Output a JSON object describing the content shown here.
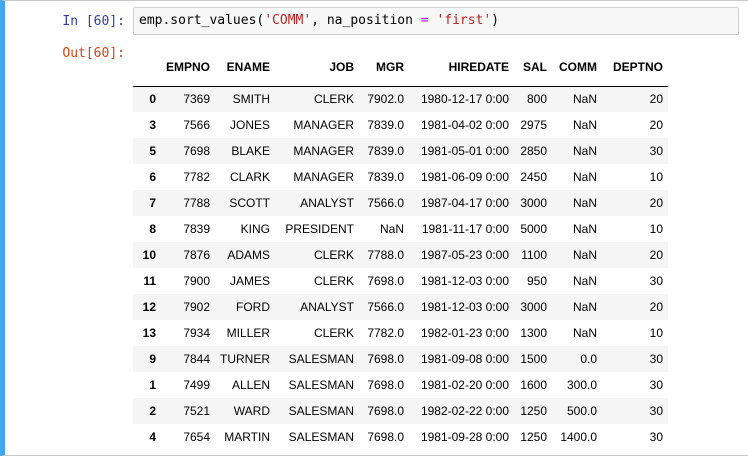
{
  "cell": {
    "in_prompt": "In [60]:",
    "out_prompt": "Out[60]:",
    "code": {
      "part1": "emp.sort_values(",
      "str1": "'COMM'",
      "part2": ", na_position ",
      "op": "=",
      "part3": " ",
      "str2": "'first'",
      "part4": ")"
    }
  },
  "table": {
    "columns": [
      "",
      "EMPNO",
      "ENAME",
      "JOB",
      "MGR",
      "HIREDATE",
      "SAL",
      "COMM",
      "DEPTNO"
    ],
    "rows": [
      [
        "0",
        "7369",
        "SMITH",
        "CLERK",
        "7902.0",
        "1980-12-17 0:00",
        "800",
        "NaN",
        "20"
      ],
      [
        "3",
        "7566",
        "JONES",
        "MANAGER",
        "7839.0",
        "1981-04-02 0:00",
        "2975",
        "NaN",
        "20"
      ],
      [
        "5",
        "7698",
        "BLAKE",
        "MANAGER",
        "7839.0",
        "1981-05-01 0:00",
        "2850",
        "NaN",
        "30"
      ],
      [
        "6",
        "7782",
        "CLARK",
        "MANAGER",
        "7839.0",
        "1981-06-09 0:00",
        "2450",
        "NaN",
        "10"
      ],
      [
        "7",
        "7788",
        "SCOTT",
        "ANALYST",
        "7566.0",
        "1987-04-17 0:00",
        "3000",
        "NaN",
        "20"
      ],
      [
        "8",
        "7839",
        "KING",
        "PRESIDENT",
        "NaN",
        "1981-11-17 0:00",
        "5000",
        "NaN",
        "10"
      ],
      [
        "10",
        "7876",
        "ADAMS",
        "CLERK",
        "7788.0",
        "1987-05-23 0:00",
        "1100",
        "NaN",
        "20"
      ],
      [
        "11",
        "7900",
        "JAMES",
        "CLERK",
        "7698.0",
        "1981-12-03 0:00",
        "950",
        "NaN",
        "30"
      ],
      [
        "12",
        "7902",
        "FORD",
        "ANALYST",
        "7566.0",
        "1981-12-03 0:00",
        "3000",
        "NaN",
        "20"
      ],
      [
        "13",
        "7934",
        "MILLER",
        "CLERK",
        "7782.0",
        "1982-01-23 0:00",
        "1300",
        "NaN",
        "10"
      ],
      [
        "9",
        "7844",
        "TURNER",
        "SALESMAN",
        "7698.0",
        "1981-09-08 0:00",
        "1500",
        "0.0",
        "30"
      ],
      [
        "1",
        "7499",
        "ALLEN",
        "SALESMAN",
        "7698.0",
        "1981-02-20 0:00",
        "1600",
        "300.0",
        "30"
      ],
      [
        "2",
        "7521",
        "WARD",
        "SALESMAN",
        "7698.0",
        "1982-02-22 0:00",
        "1250",
        "500.0",
        "30"
      ],
      [
        "4",
        "7654",
        "MARTIN",
        "SALESMAN",
        "7698.0",
        "1981-09-28 0:00",
        "1250",
        "1400.0",
        "30"
      ]
    ]
  },
  "colors": {
    "cell_border_accent": "#42a5f5",
    "in_prompt": "#303f9f",
    "out_prompt": "#d84315",
    "string_token": "#ba2121",
    "operator_token": "#aa22ff",
    "striped_row": "#f5f5f5"
  }
}
